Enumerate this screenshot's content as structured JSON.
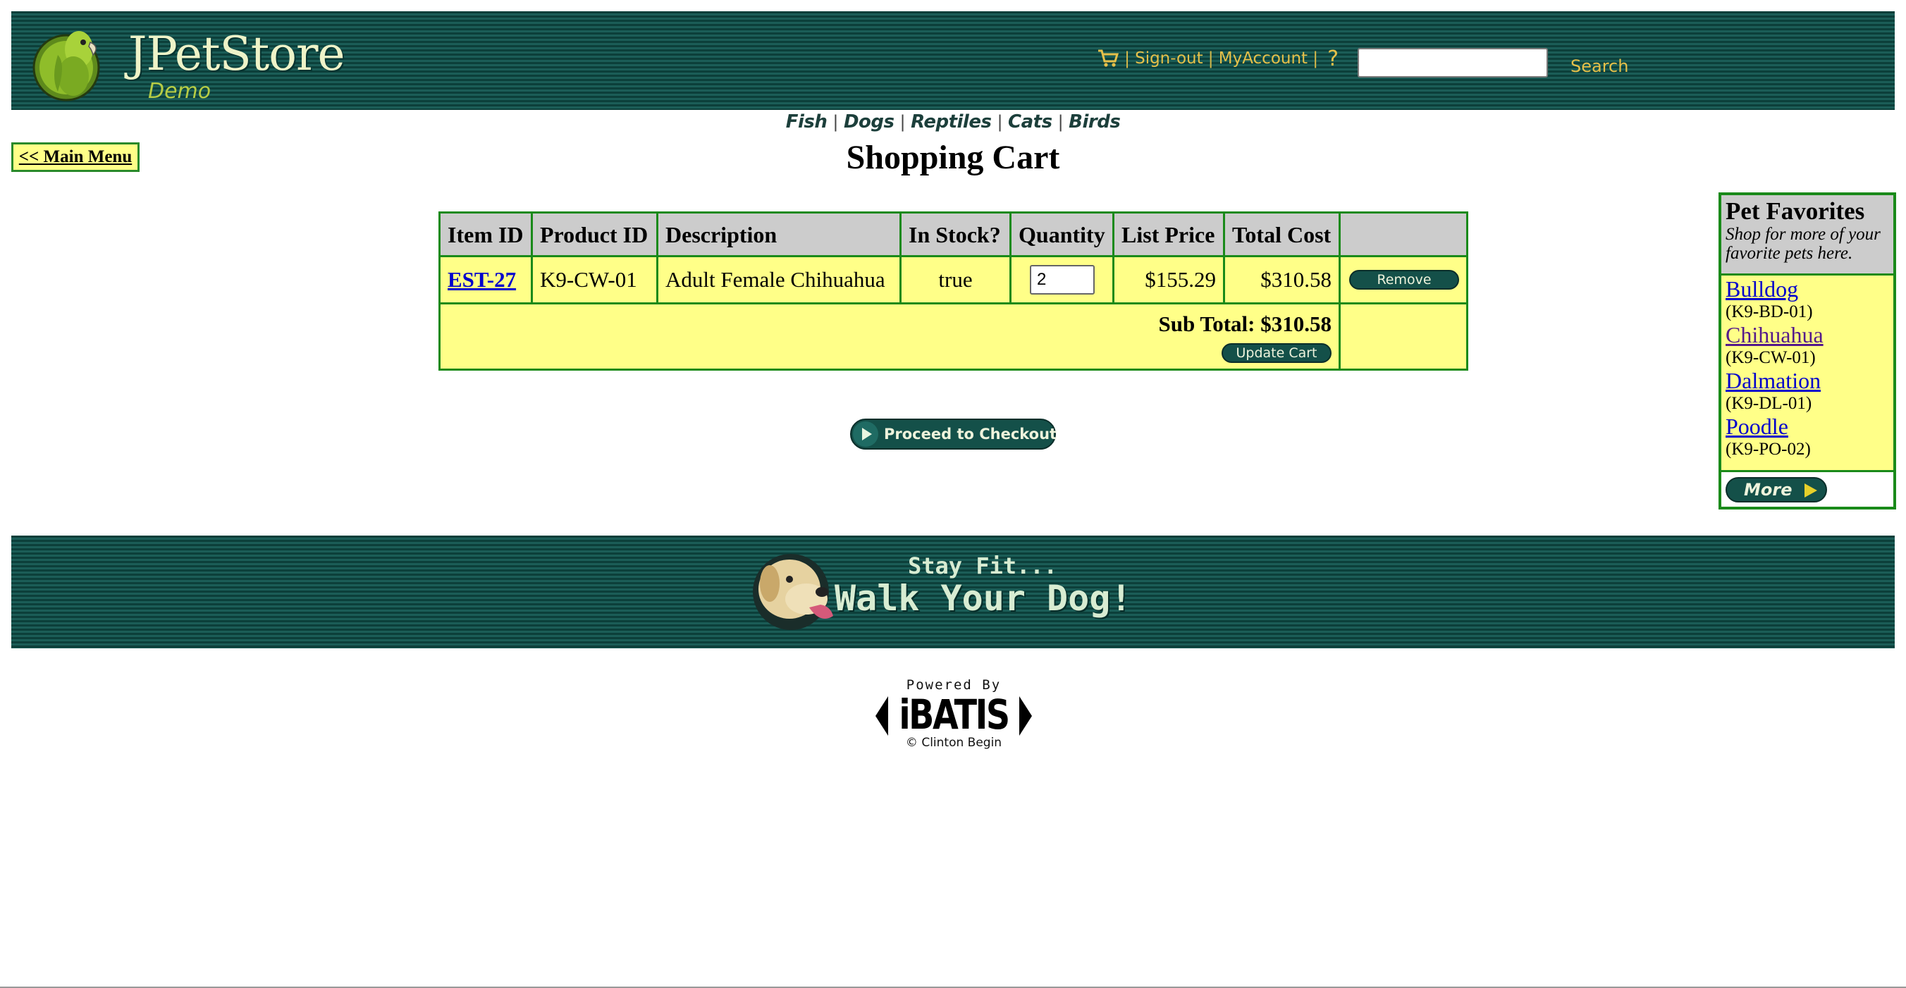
{
  "header": {
    "logo_title": "JPetStore",
    "logo_subtitle": "Demo",
    "links": {
      "sign_out": "Sign-out",
      "my_account": "MyAccount",
      "help": "?"
    },
    "search": {
      "value": "",
      "button": "Search"
    },
    "icons": [
      "parrot-logo",
      "cart-icon",
      "help-icon"
    ]
  },
  "categories": [
    "Fish",
    "Dogs",
    "Reptiles",
    "Cats",
    "Birds"
  ],
  "main_menu_label": "<< Main Menu",
  "page_title": "Shopping Cart",
  "cart": {
    "columns": [
      "Item ID",
      "Product ID",
      "Description",
      "In Stock?",
      "Quantity",
      "List Price",
      "Total Cost",
      ""
    ],
    "rows": [
      {
        "item_id": "EST-27",
        "product_id": "K9-CW-01",
        "description": "Adult Female Chihuahua",
        "in_stock": "true",
        "quantity": "2",
        "list_price": "$155.29",
        "total_cost": "$310.58",
        "remove_label": "Remove"
      }
    ],
    "subtotal": "Sub Total: $310.58",
    "update_label": "Update Cart"
  },
  "checkout_label": "Proceed to Checkout",
  "favorites": {
    "title": "Pet Favorites",
    "description": "Shop for more of your favorite pets here.",
    "items": [
      {
        "name": "Bulldog",
        "code": "(K9-BD-01)"
      },
      {
        "name": "Chihuahua",
        "code": "(K9-CW-01)"
      },
      {
        "name": "Dalmation",
        "code": "(K9-DL-01)"
      },
      {
        "name": "Poodle",
        "code": "(K9-PO-02)"
      }
    ],
    "more_label": "More"
  },
  "banner": {
    "line1": "Stay Fit...",
    "line2": "Walk Your Dog!"
  },
  "footer": {
    "powered_by": "Powered By",
    "brand": "iBATIS",
    "credit": "© Clinton Begin"
  },
  "colors": {
    "header_bg": "#0f4a44",
    "link_gold": "#e5c04a",
    "table_border": "#1a8a1a",
    "cell_yellow": "#ffff88",
    "header_gray": "#cccccc",
    "link_blue": "#0000cc"
  }
}
